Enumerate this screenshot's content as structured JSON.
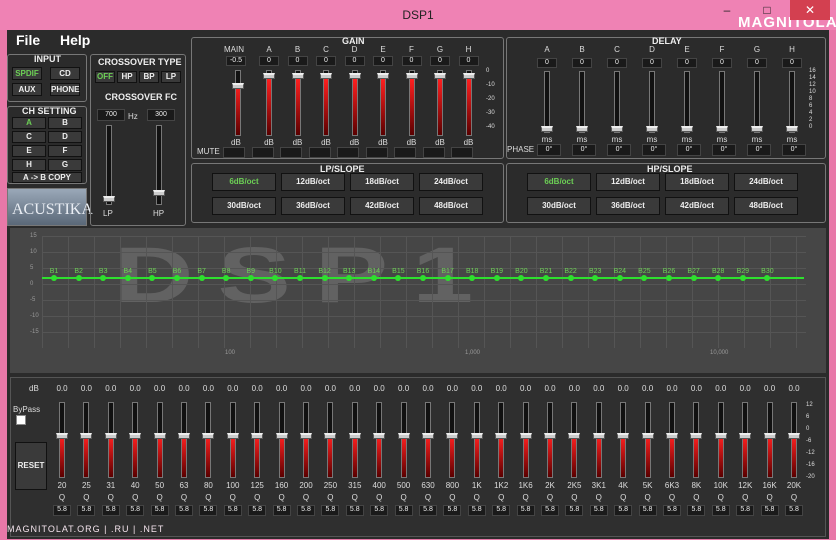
{
  "title": "DSP1",
  "window": {
    "minimize": "–",
    "maximize": "□",
    "close": "✕",
    "logo": "MAGNITOLA"
  },
  "menu": {
    "file": "File",
    "help": "Help"
  },
  "input": {
    "title": "INPUT",
    "spdif": "SPDIF",
    "cd": "CD",
    "aux": "AUX",
    "phone": "PHONE"
  },
  "ch": {
    "title": "CH SETTING",
    "channels": [
      "A",
      "B",
      "C",
      "D",
      "E",
      "F",
      "H",
      "G"
    ],
    "copy": "A -> B COPY"
  },
  "brand": "ACUSTIKA",
  "crossover": {
    "type_title": "CROSSOVER TYPE",
    "types": [
      "OFF",
      "HP",
      "BP",
      "LP"
    ],
    "fc_title": "CROSSOVER FC",
    "lp_value": "700",
    "hz": "Hz",
    "hp_value": "300",
    "lp": "LP",
    "hp": "HP"
  },
  "gain": {
    "title": "GAIN",
    "main_label": "MAIN",
    "channels": [
      "A",
      "B",
      "C",
      "D",
      "E",
      "F",
      "G",
      "H"
    ],
    "main_value": "-0.5",
    "values": [
      "0",
      "0",
      "0",
      "0",
      "0",
      "0",
      "0",
      "0"
    ],
    "unit": "dB",
    "mute": "MUTE",
    "scale": [
      "0",
      "-10",
      "-20",
      "-30",
      "-40"
    ]
  },
  "delay": {
    "title": "DELAY",
    "channels": [
      "A",
      "B",
      "C",
      "D",
      "E",
      "F",
      "G",
      "H"
    ],
    "values": [
      "0",
      "0",
      "0",
      "0",
      "0",
      "0",
      "0",
      "0"
    ],
    "unit": "ms",
    "phase": "PHASE",
    "phases": [
      "0°",
      "0°",
      "0°",
      "0°",
      "0°",
      "0°",
      "0°",
      "0°"
    ],
    "scale": [
      "16",
      "14",
      "12",
      "10",
      "8",
      "6",
      "4",
      "2",
      "0"
    ]
  },
  "lpslope": {
    "title": "LP/SLOPE",
    "options": [
      "6dB/oct",
      "12dB/oct",
      "18dB/oct",
      "24dB/oct",
      "30dB/oct",
      "36dB/oct",
      "42dB/oct",
      "48dB/oct"
    ]
  },
  "hpslope": {
    "title": "HP/SLOPE",
    "options": [
      "6dB/oct",
      "12dB/oct",
      "18dB/oct",
      "24dB/oct",
      "30dB/oct",
      "36dB/oct",
      "42dB/oct",
      "48dB/oct"
    ]
  },
  "graph": {
    "watermark": "DSP1",
    "yticks": [
      "15",
      "10",
      "5",
      "0",
      "-5",
      "-10",
      "-15"
    ],
    "xticks": [
      "100",
      "1,000",
      "10,000"
    ],
    "bands": [
      "B1",
      "B2",
      "B3",
      "B4",
      "B5",
      "B6",
      "B7",
      "B8",
      "B9",
      "B10",
      "B11",
      "B12",
      "B13",
      "B14",
      "B15",
      "B16",
      "B17",
      "B18",
      "B19",
      "B20",
      "B21",
      "B22",
      "B23",
      "B24",
      "B25",
      "B26",
      "B27",
      "B28",
      "B29",
      "B30"
    ]
  },
  "eq": {
    "db": "dB",
    "values": [
      "0.0",
      "0.0",
      "0.0",
      "0.0",
      "0.0",
      "0.0",
      "0.0",
      "0.0",
      "0.0",
      "0.0",
      "0.0",
      "0.0",
      "0.0",
      "0.0",
      "0.0",
      "0.0",
      "0.0",
      "0.0",
      "0.0",
      "0.0",
      "0.0",
      "0.0",
      "0.0",
      "0.0",
      "0.0",
      "0.0",
      "0.0",
      "0.0",
      "0.0",
      "0.0",
      "0.0"
    ],
    "freqs": [
      "20",
      "25",
      "31",
      "40",
      "50",
      "63",
      "80",
      "100",
      "125",
      "160",
      "200",
      "250",
      "315",
      "400",
      "500",
      "630",
      "800",
      "1K",
      "1K2",
      "1K6",
      "2K",
      "2K5",
      "3K1",
      "4K",
      "5K",
      "6K3",
      "8K",
      "10K",
      "12K",
      "16K",
      "20K"
    ],
    "q": "Q",
    "qvals": [
      "5.8",
      "5.8",
      "5.8",
      "5.8",
      "5.8",
      "5.8",
      "5.8",
      "5.8",
      "5.8",
      "5.8",
      "5.8",
      "5.8",
      "5.8",
      "5.8",
      "5.8",
      "5.8",
      "5.8",
      "5.8",
      "5.8",
      "5.8",
      "5.8",
      "5.8",
      "5.8",
      "5.8",
      "5.8",
      "5.8",
      "5.8",
      "5.8",
      "5.8",
      "5.8",
      "5.8"
    ],
    "bypass": "ByPass",
    "reset": "RESET",
    "scale": [
      "12",
      "6",
      "0",
      "-6",
      "-12",
      "-16",
      "-20"
    ]
  },
  "footer": "MAGNITOLAT.ORG | .RU | .NET"
}
